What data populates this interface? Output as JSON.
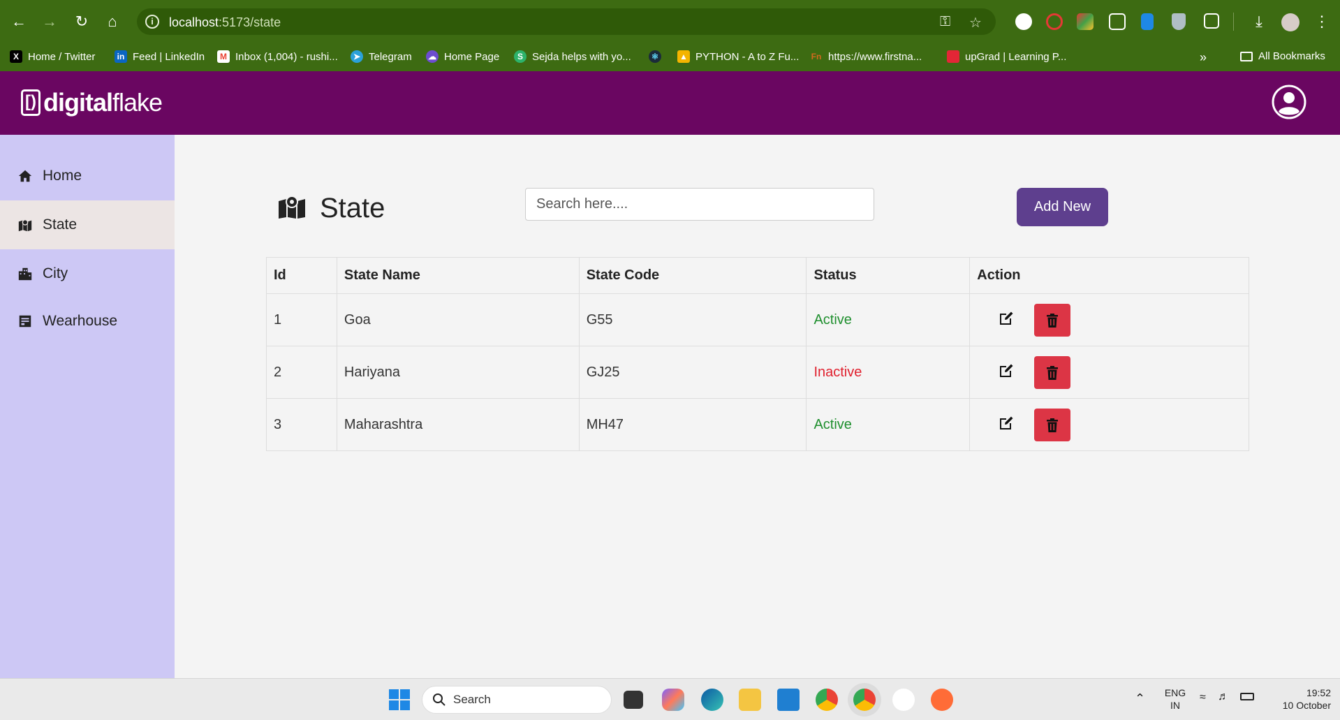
{
  "browser": {
    "url_host": "localhost",
    "url_path": ":5173/state",
    "bookmarks": [
      {
        "label": "Home / Twitter",
        "icon": "x-logo",
        "color": "#000000"
      },
      {
        "label": "Feed | LinkedIn",
        "icon": "linkedin-logo",
        "color": "#0a66c2"
      },
      {
        "label": "Inbox (1,004) - rushi...",
        "icon": "gmail-logo",
        "color": "#ea4335"
      },
      {
        "label": "Telegram",
        "icon": "telegram-logo",
        "color": "#2aa1da"
      },
      {
        "label": "Home Page",
        "icon": "cloud-logo",
        "color": "#6c4cd0"
      },
      {
        "label": "Sejda helps with yo...",
        "icon": "sejda-logo",
        "color": "#2db36b"
      },
      {
        "label": "",
        "icon": "react-logo",
        "color": "#1b2b3a"
      },
      {
        "label": "PYTHON - A to Z Fu...",
        "icon": "drive-logo",
        "color": "#f4b400"
      },
      {
        "label": "https://www.firstna...",
        "icon": "fn-logo",
        "color": "#d2691e"
      },
      {
        "label": "upGrad | Learning P...",
        "icon": "upgrad-logo",
        "color": "#e32636"
      }
    ],
    "all_bookmarks_label": "All Bookmarks"
  },
  "app": {
    "logo_bracket": "[)",
    "logo_bold": "digital",
    "logo_light": "flake"
  },
  "sidebar": {
    "items": [
      {
        "label": "Home",
        "icon": "home-icon"
      },
      {
        "label": "State",
        "icon": "map-icon",
        "active": true
      },
      {
        "label": "City",
        "icon": "city-icon"
      },
      {
        "label": "Wearhouse",
        "icon": "warehouse-icon"
      }
    ]
  },
  "main": {
    "title": "State",
    "search_placeholder": "Search here....",
    "add_button": "Add New",
    "columns": [
      "Id",
      "State Name",
      "State Code",
      "Status",
      "Action"
    ],
    "rows": [
      {
        "id": "1",
        "name": "Goa",
        "code": "G55",
        "status": "Active"
      },
      {
        "id": "2",
        "name": "Hariyana",
        "code": "GJ25",
        "status": "Inactive"
      },
      {
        "id": "3",
        "name": "Maharashtra",
        "code": "MH47",
        "status": "Active"
      }
    ],
    "colors": {
      "active": "#1f8f2e",
      "inactive": "#e0202e",
      "delete": "#dc3545",
      "primary": "#5e3f8e",
      "header": "#6a0661",
      "sidebar": "#cdc8f5"
    }
  },
  "taskbar": {
    "search_label": "Search",
    "lang_top": "ENG",
    "lang_bottom": "IN",
    "time": "19:52",
    "date": "10 October"
  }
}
